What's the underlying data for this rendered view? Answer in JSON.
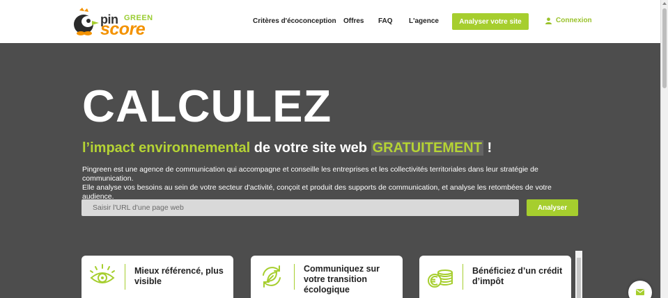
{
  "header": {
    "logo": {
      "pin": "pin",
      "green": "GREEN",
      "score": "score"
    },
    "nav": [
      {
        "label": "Critères d'écoconception"
      },
      {
        "label": "Offres"
      },
      {
        "label": "FAQ"
      },
      {
        "label": "L'agence"
      }
    ],
    "cta_label": "Analyser votre site",
    "login_label": "Connexion"
  },
  "hero": {
    "title": "CALCULEZ",
    "subtitle_part1": "l’impact environnemental",
    "subtitle_part2": " de votre site web ",
    "subtitle_part3": "GRATUITEMENT",
    "subtitle_part4": " !",
    "description_line1": "Pingreen est une agence de communication qui accompagne et conseille les entreprises et les collectivités territoriales dans leur stratégie de communication.",
    "description_line2": "Elle analyse vos besoins au sein de votre secteur d'activité, conçoit et produit des supports de communication, et analyse les retombées de votre audience."
  },
  "search": {
    "placeholder": "Saisir l'URL d'une page web",
    "value": "",
    "button_label": "Analyser"
  },
  "cards": [
    {
      "line1": "Mieux référencé, plus",
      "line2": "visible",
      "line3": "",
      "icon": "eye-icon"
    },
    {
      "line1": "Communiquez sur",
      "line2": "votre transition",
      "line3": "écologique",
      "icon": "recycle-leaf-icon"
    },
    {
      "line1": "Bénéficiez d’un crédit",
      "line2": "d’impôt",
      "line3": "",
      "icon": "euro-coins-icon"
    }
  ],
  "colors": {
    "accent": "#a6ce2e",
    "lime_text": "#b5d334",
    "background": "#4d4d4d",
    "logo_orange": "#f39200"
  }
}
